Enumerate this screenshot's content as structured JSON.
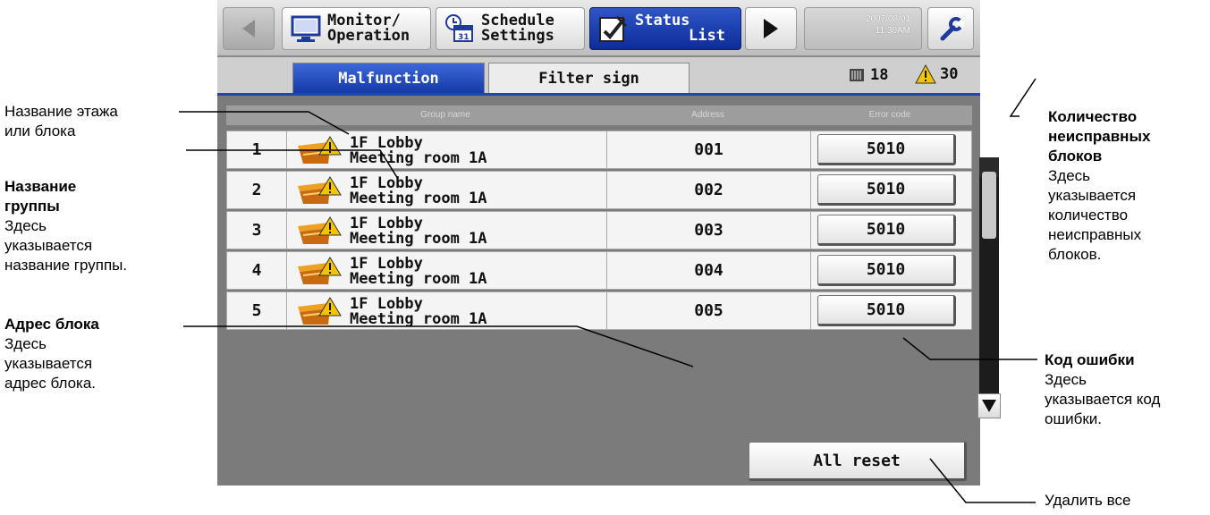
{
  "nav": {
    "monitor_line1": "Monitor/",
    "monitor_line2": "Operation",
    "schedule_line1": "Schedule",
    "schedule_line2": "Settings",
    "status_line1": "Status",
    "status_line2": "List",
    "date": "2007/08/01",
    "time": "11:30AM"
  },
  "tabs": {
    "malfunction": "Malfunction",
    "filter_sign": "Filter sign"
  },
  "counts": {
    "units": "18",
    "faults": "30"
  },
  "table": {
    "headers": [
      "Group name",
      "Address",
      "Error code"
    ],
    "rows": [
      {
        "num": "1",
        "floor": "1F Lobby",
        "group": "Meeting room 1A",
        "address": "001",
        "error": "5010"
      },
      {
        "num": "2",
        "floor": "1F Lobby",
        "group": "Meeting room 1A",
        "address": "002",
        "error": "5010"
      },
      {
        "num": "3",
        "floor": "1F Lobby",
        "group": "Meeting room 1A",
        "address": "003",
        "error": "5010"
      },
      {
        "num": "4",
        "floor": "1F Lobby",
        "group": "Meeting room 1A",
        "address": "004",
        "error": "5010"
      },
      {
        "num": "5",
        "floor": "1F Lobby",
        "group": "Meeting room 1A",
        "address": "005",
        "error": "5010"
      }
    ]
  },
  "footer": {
    "all_reset": "All reset"
  },
  "annotations": {
    "floor_name_1": "Название этажа",
    "floor_name_2": "или блока",
    "group_title_1": "Название",
    "group_title_2": "группы",
    "group_desc_1": "Здесь",
    "group_desc_2": "указывается",
    "group_desc_3": "название группы.",
    "addr_title": "Адрес блока",
    "addr_desc_1": "Здесь",
    "addr_desc_2": "указывается",
    "addr_desc_3": "адрес блока.",
    "count_title_1": "Количество",
    "count_title_2": "неисправных",
    "count_title_3": "блоков",
    "count_desc_1": "Здесь",
    "count_desc_2": "указывается",
    "count_desc_3": "количество",
    "count_desc_4": "неисправных",
    "count_desc_5": "блоков.",
    "err_title": "Код ошибки",
    "err_desc_1": "Здесь",
    "err_desc_2": "указывается код",
    "err_desc_3": "ошибки.",
    "delete_all": "Удалить все"
  },
  "colors": {
    "active_tab": "#1e45b5",
    "screen_bg": "#7b7b7b",
    "warning": "#f5c400"
  }
}
